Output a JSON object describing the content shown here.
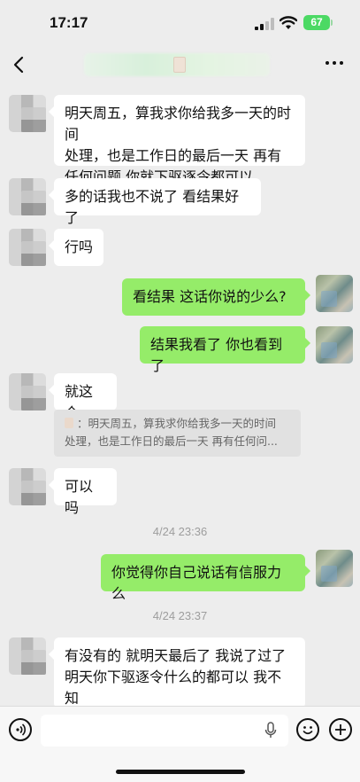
{
  "status_bar": {
    "time": "17:17",
    "battery": "67"
  },
  "nav": {
    "back_icon": "chevron-left-icon",
    "more_label": "···"
  },
  "messages": [
    {
      "from": "other",
      "text": "明天周五，算我求你给我多一天的时间\n处理，也是工作日的最后一天 再有\n任何问题 你就下驱逐令都可以"
    },
    {
      "from": "other",
      "text": "多的话我也不说了 看结果好了"
    },
    {
      "from": "other",
      "text": "行吗"
    },
    {
      "from": "self",
      "text": "看结果 这话你说的少么?"
    },
    {
      "from": "self",
      "text": "结果我看了 你也看到了"
    },
    {
      "from": "other",
      "text": "就这个"
    },
    {
      "from": "other",
      "text": "可以吗"
    },
    {
      "from": "self",
      "text": "你觉得你自己说话有信服力么"
    },
    {
      "from": "other",
      "text": "有没有的 就明天最后了 我说了过了\n明天你下驱逐令什么的都可以 我不知\n道还要怎么样现在"
    }
  ],
  "quote": {
    "text": "：明天周五，算我求你给我多一天的时间\n处理，也是工作日的最后一天 再有任何问..."
  },
  "timestamps": [
    "4/24 23:36",
    "4/24 23:37"
  ],
  "input_bar": {
    "voice_icon": "voice-icon",
    "mic_icon": "mic-icon",
    "emoji_icon": "emoji-icon",
    "plus_icon": "plus-icon",
    "text": ""
  },
  "colors": {
    "background": "#ededed",
    "self_bubble": "#95ec69",
    "other_bubble": "#ffffff"
  }
}
